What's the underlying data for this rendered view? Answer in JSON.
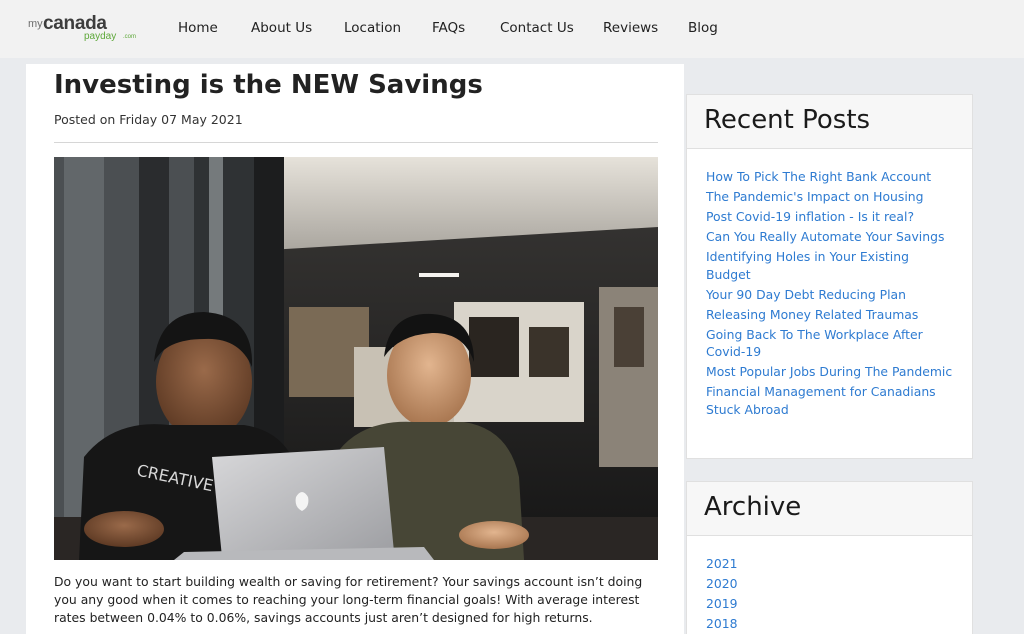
{
  "brand": {
    "logo_my": "my",
    "logo_canada": "canada",
    "logo_payday": "payday",
    "logo_com": ".com"
  },
  "nav": {
    "items": [
      "Home",
      "About Us",
      "Location",
      "FAQs",
      "Contact Us",
      "Reviews",
      "Blog"
    ]
  },
  "post": {
    "title": "Investing is the NEW Savings",
    "date": "Posted on Friday 07 May 2021",
    "image_alt": "Two men smiling while looking at a laptop",
    "shirt_text": "CREATIVE",
    "body": "Do you want to start building wealth or saving for retirement? Your savings account isn’t doing you any good when it comes to reaching your long-term financial goals! With average interest rates between 0.04% to 0.06%, savings accounts just aren’t designed for high returns."
  },
  "sidebar": {
    "recent_title": "Recent Posts",
    "recent_posts": [
      "How To Pick The Right Bank Account",
      "The Pandemic's Impact on Housing",
      "Post Covid-19 inflation - Is it real?",
      "Can You Really Automate Your Savings",
      "Identifying Holes in Your Existing Budget",
      "Your 90 Day Debt Reducing Plan",
      "Releasing Money Related Traumas",
      "Going Back To The Workplace After Covid-19",
      "Most Popular Jobs During The Pandemic",
      "Financial Management for Canadians Stuck Abroad"
    ],
    "archive_title": "Archive",
    "archive_years": [
      "2021",
      "2020",
      "2019",
      "2018"
    ]
  },
  "colors": {
    "link": "#2e7bd1",
    "page_bg": "#e9ebee",
    "header_bg": "#f2f2f2",
    "logo_green": "#5ea83a"
  }
}
